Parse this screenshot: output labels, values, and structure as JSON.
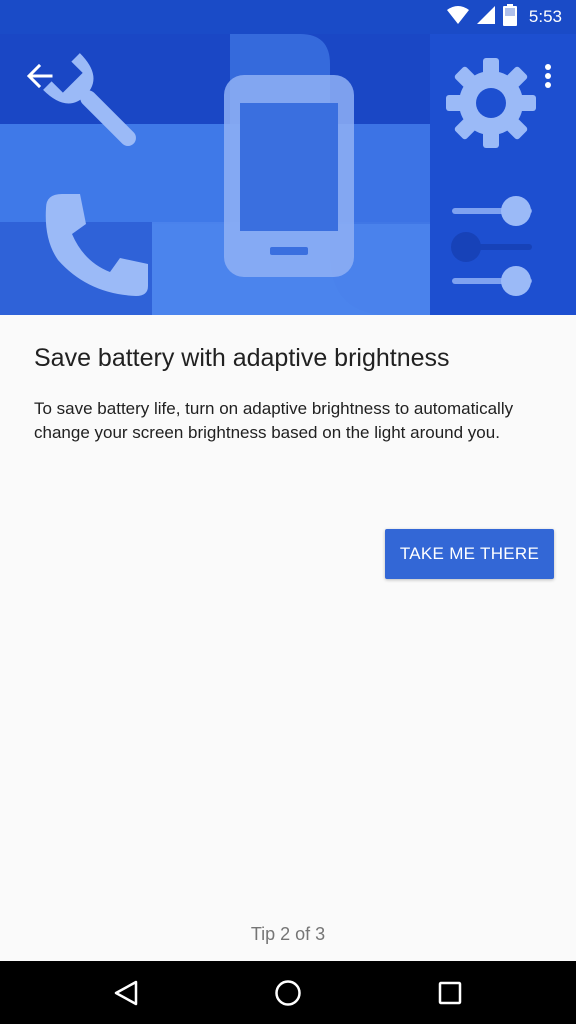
{
  "status_bar": {
    "time": "5:53",
    "battery_level": "52"
  },
  "toolbar": {
    "back_icon": "arrow-back-icon",
    "overflow_icon": "more-vert-icon"
  },
  "hero": {
    "illustration_icons": [
      "wrench-icon",
      "phone-device-icon",
      "gear-icon",
      "phone-handset-icon",
      "sliders-icon"
    ]
  },
  "content": {
    "title": "Save battery with adaptive brightness",
    "description": "To save battery life, turn on adaptive brightness to automatically change your screen brightness based on the light around you.",
    "action_label": "TAKE ME THERE"
  },
  "footer": {
    "tip_text": "Tip 2 of 3"
  },
  "colors": {
    "accent": "#3367d6",
    "hero_dark": "#1a47c5",
    "hero_light": "#3f79e8"
  }
}
